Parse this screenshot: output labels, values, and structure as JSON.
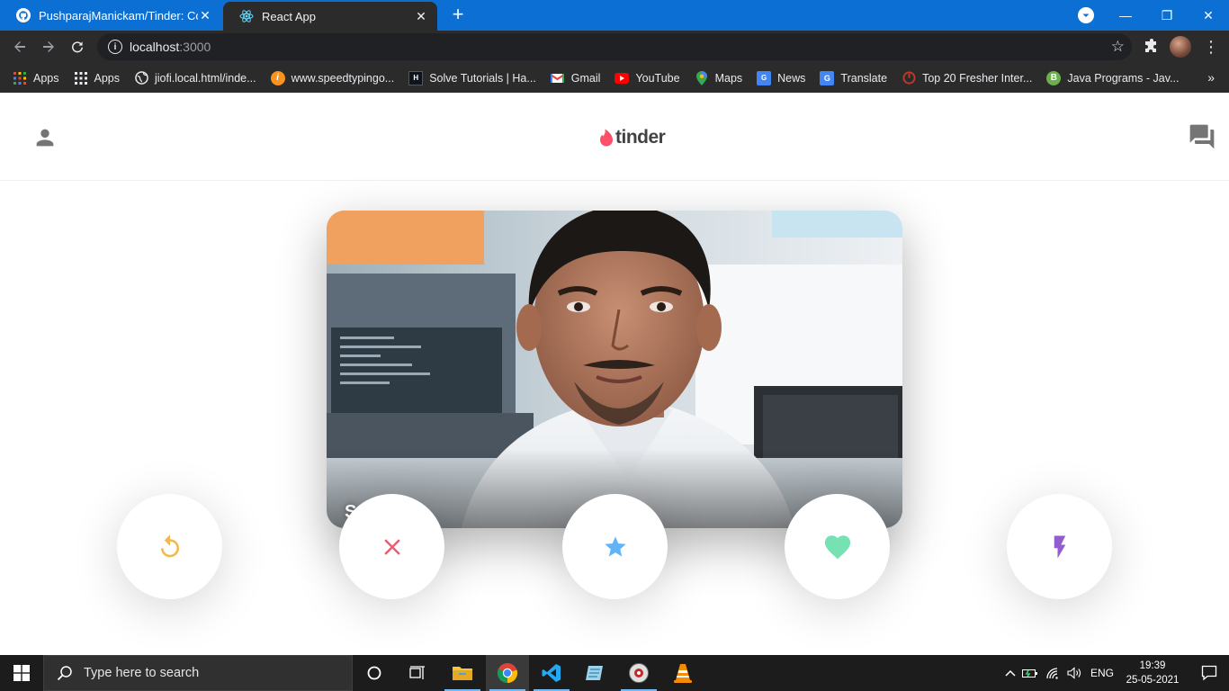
{
  "browser": {
    "tabs": [
      {
        "title": "PushparajManickam/Tinder: Conte",
        "close": "✕"
      },
      {
        "title": "React App",
        "close": "✕"
      }
    ],
    "new_tab": "+",
    "window_controls": {
      "minimize": "—",
      "restore": "❐",
      "close": "✕"
    },
    "url_host": "localhost",
    "url_port": ":3000",
    "bookmarks": [
      {
        "label": "Apps",
        "icon": "apps-grid-color"
      },
      {
        "label": "Apps",
        "icon": "apps-grid"
      },
      {
        "label": "jiofi.local.html/inde...",
        "icon": "globe"
      },
      {
        "label": "www.speedtypingo...",
        "icon": "speedtyping"
      },
      {
        "label": "Solve Tutorials | Ha...",
        "icon": "hackerrank"
      },
      {
        "label": "Gmail",
        "icon": "gmail"
      },
      {
        "label": "YouTube",
        "icon": "youtube"
      },
      {
        "label": "Maps",
        "icon": "maps"
      },
      {
        "label": "News",
        "icon": "news"
      },
      {
        "label": "Translate",
        "icon": "translate"
      },
      {
        "label": "Top 20 Fresher Inter...",
        "icon": "interview"
      },
      {
        "label": "Java Programs - Jav...",
        "icon": "java-b"
      }
    ],
    "bookmarks_overflow": "»"
  },
  "app": {
    "logo_text": "tinder",
    "card": {
      "name": "Su"
    },
    "colors": {
      "replay": "#f5b748",
      "close": "#ec5e6f",
      "star": "#62b4f9",
      "heart": "#76e2b3",
      "flash": "#915dd1",
      "flame": "#fd5068",
      "header_icons": "#757575"
    }
  },
  "taskbar": {
    "search_placeholder": "Type here to search",
    "language": "ENG",
    "time": "19:39",
    "date": "25-05-2021"
  }
}
